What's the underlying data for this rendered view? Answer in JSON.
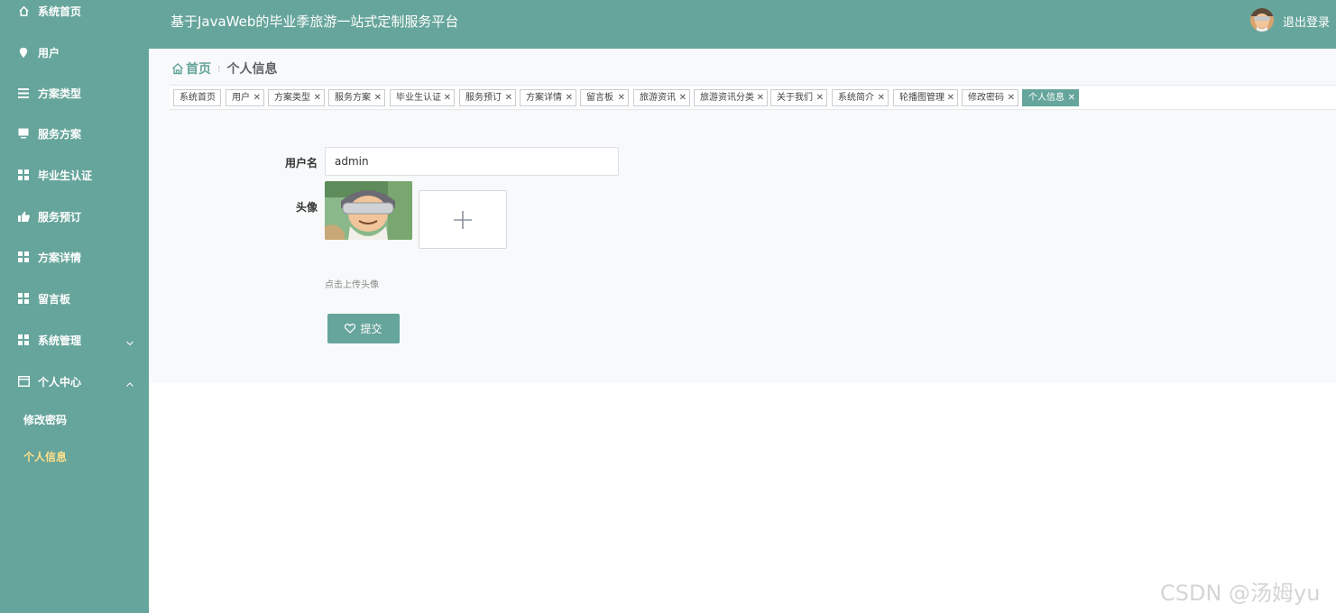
{
  "app": {
    "title": "基于JavaWeb的毕业季旅游一站式定制服务平台",
    "logout_label": "退出登录"
  },
  "sidebar": {
    "items": [
      {
        "label": "系统首页",
        "icon": "home-icon"
      },
      {
        "label": "用户",
        "icon": "pin-icon"
      },
      {
        "label": "方案类型",
        "icon": "list-icon"
      },
      {
        "label": "服务方案",
        "icon": "monitor-icon"
      },
      {
        "label": "毕业生认证",
        "icon": "grid-icon"
      },
      {
        "label": "服务预订",
        "icon": "thumbs-up-icon"
      },
      {
        "label": "方案详情",
        "icon": "grid-icon"
      },
      {
        "label": "留言板",
        "icon": "grid-icon"
      },
      {
        "label": "系统管理",
        "icon": "grid-icon",
        "arrow": "chevron-down-icon"
      },
      {
        "label": "个人中心",
        "icon": "window-icon",
        "arrow": "chevron-up-icon"
      }
    ],
    "sub_items": [
      {
        "label": "修改密码",
        "active": false
      },
      {
        "label": "个人信息",
        "active": true
      }
    ]
  },
  "breadcrumb": {
    "home": "首页",
    "current": "个人信息"
  },
  "tabs": [
    {
      "label": "系统首页",
      "closable": false
    },
    {
      "label": "用户",
      "closable": true
    },
    {
      "label": "方案类型",
      "closable": true
    },
    {
      "label": "服务方案",
      "closable": true
    },
    {
      "label": "毕业生认证",
      "closable": true
    },
    {
      "label": "服务预订",
      "closable": true
    },
    {
      "label": "方案详情",
      "closable": true
    },
    {
      "label": "留言板",
      "closable": true
    },
    {
      "label": "旅游资讯",
      "closable": true
    },
    {
      "label": "旅游资讯分类",
      "closable": true
    },
    {
      "label": "关于我们",
      "closable": true
    },
    {
      "label": "系统简介",
      "closable": true
    },
    {
      "label": "轮播图管理",
      "closable": true
    },
    {
      "label": "修改密码",
      "closable": true
    },
    {
      "label": "个人信息",
      "closable": true,
      "active": true
    }
  ],
  "form": {
    "username_label": "用户名",
    "username_value": "admin",
    "avatar_label": "头像",
    "upload_hint": "点击上传头像",
    "submit_label": "提交"
  },
  "watermark": "CSDN @汤姆yu",
  "colors": {
    "primary": "#66a59b",
    "active_sub_item": "#ffe08a",
    "main_bg": "#f7f9fa"
  }
}
